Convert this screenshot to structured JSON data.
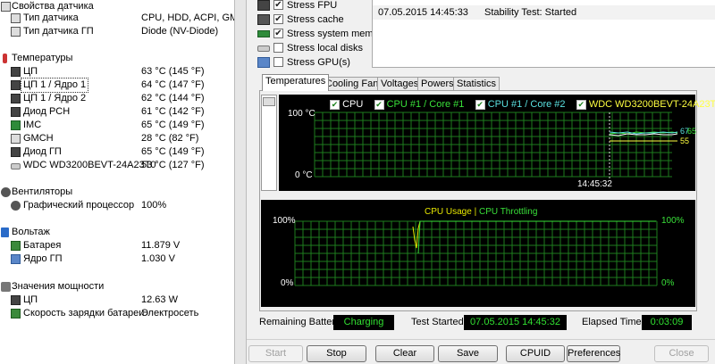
{
  "sensor_panel": {
    "sensor_props": {
      "title": "Свойства датчика",
      "items": [
        {
          "label": "Тип датчика",
          "value": "CPU, HDD, ACPI, GMCH"
        },
        {
          "label": "Тип датчика ГП",
          "value": "Diode  (NV-Diode)"
        }
      ]
    },
    "temperatures": {
      "title": "Температуры",
      "items": [
        {
          "label": "ЦП",
          "value": "63 °C  (145 °F)"
        },
        {
          "label": "ЦП 1 / Ядро 1",
          "value": "64 °C  (147 °F)"
        },
        {
          "label": "ЦП 1 / Ядро 2",
          "value": "62 °C  (144 °F)"
        },
        {
          "label": "Диод PCH",
          "value": "61 °C  (142 °F)"
        },
        {
          "label": "IMC",
          "value": "65 °C  (149 °F)"
        },
        {
          "label": "GMCH",
          "value": "28 °C  (82 °F)"
        },
        {
          "label": "Диод ГП",
          "value": "65 °C  (149 °F)"
        },
        {
          "label": "WDC WD3200BEVT-24A23T0",
          "value": "53 °C  (127 °F)"
        }
      ]
    },
    "fans": {
      "title": "Вентиляторы",
      "items": [
        {
          "label": "Графический процессор",
          "value": "100%"
        }
      ]
    },
    "voltages": {
      "title": "Вольтаж",
      "items": [
        {
          "label": "Батарея",
          "value": "11.879 V"
        },
        {
          "label": "Ядро ГП",
          "value": "1.030 V"
        }
      ]
    },
    "power": {
      "title": "Значения мощности",
      "items": [
        {
          "label": "ЦП",
          "value": "12.63 W"
        },
        {
          "label": "Скорость зарядки батареи",
          "value": "Электросеть"
        }
      ]
    }
  },
  "stress_options": [
    {
      "label": "Stress FPU",
      "checked": true,
      "icon": "fpu-icon"
    },
    {
      "label": "Stress cache",
      "checked": true,
      "icon": "cache-icon"
    },
    {
      "label": "Stress system memory",
      "checked": true,
      "icon": "memory-icon"
    },
    {
      "label": "Stress local disks",
      "checked": false,
      "icon": "disk-icon"
    },
    {
      "label": "Stress GPU(s)",
      "checked": false,
      "icon": "gpu-icon"
    }
  ],
  "log": {
    "date": "07.05.2015 14:45:33",
    "event": "Stability Test: Started"
  },
  "tabs": [
    "Temperatures",
    "Cooling Fans",
    "Voltages",
    "Powers",
    "Statistics"
  ],
  "temp_graph": {
    "legend": [
      "CPU",
      "CPU #1 / Core #1",
      "CPU #1 / Core #2",
      "WDC WD3200BEVT-24A23T0"
    ],
    "legend_colors": [
      "#ffffff",
      "#39e039",
      "#ffff40",
      "#e0e0e0"
    ],
    "ymax_label": "100 °C",
    "ymin_label": "0 °C",
    "time_label": "14:45:32",
    "value_labels": [
      "67",
      "65",
      "55"
    ]
  },
  "usage_graph": {
    "title_usage": "CPU Usage",
    "separator": "|",
    "title_throttle": "CPU Throttling",
    "left_top": "100%",
    "left_bottom": "0%",
    "right_top": "100%",
    "right_bottom": "0%"
  },
  "status": {
    "remaining_battery_label": "Remaining Battery:",
    "remaining_battery_value": "Charging",
    "test_started_label": "Test Started:",
    "test_started_value": "07.05.2015 14:45:32",
    "elapsed_label": "Elapsed Time:",
    "elapsed_value": "0:03:09"
  },
  "buttons": {
    "start": "Start",
    "stop": "Stop",
    "clear": "Clear",
    "save": "Save",
    "cpuid": "CPUID",
    "preferences": "Preferences",
    "close": "Close"
  },
  "colors": {
    "graph_bg": "#000000",
    "grid": "#1e7d1e",
    "value_green": "#31e031",
    "text_yellow": "#e8e800"
  }
}
